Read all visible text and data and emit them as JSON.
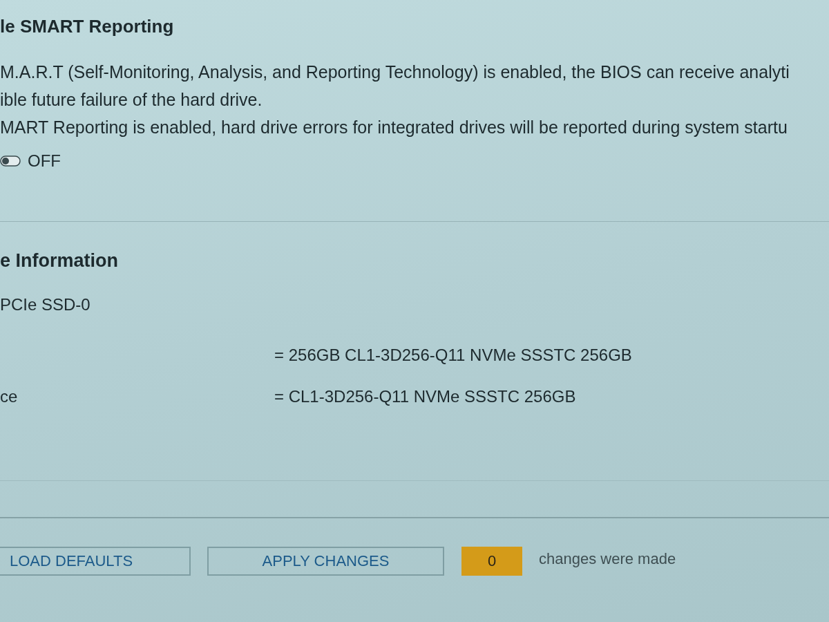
{
  "smart_section": {
    "title": "le SMART Reporting",
    "description_lines": [
      "M.A.R.T (Self-Monitoring, Analysis, and Reporting Technology) is enabled, the BIOS can receive analyti",
      "ible future failure of the hard drive.",
      "MART Reporting is enabled, hard drive errors for integrated drives will be reported during system startu"
    ],
    "toggle": {
      "label": "OFF",
      "on": false
    }
  },
  "drive_section": {
    "title": "e Information",
    "device": "PCIe SSD-0",
    "rows": [
      {
        "value": "= 256GB CL1-3D256-Q11 NVMe SSSTC 256GB"
      },
      {
        "label": "ce",
        "value": "= CL1-3D256-Q11 NVMe SSSTC 256GB"
      }
    ]
  },
  "footer": {
    "buttons": [
      "LOAD DEFAULTS",
      "APPLY CHANGES"
    ],
    "change_count": "0",
    "change_text": "changes were made"
  }
}
